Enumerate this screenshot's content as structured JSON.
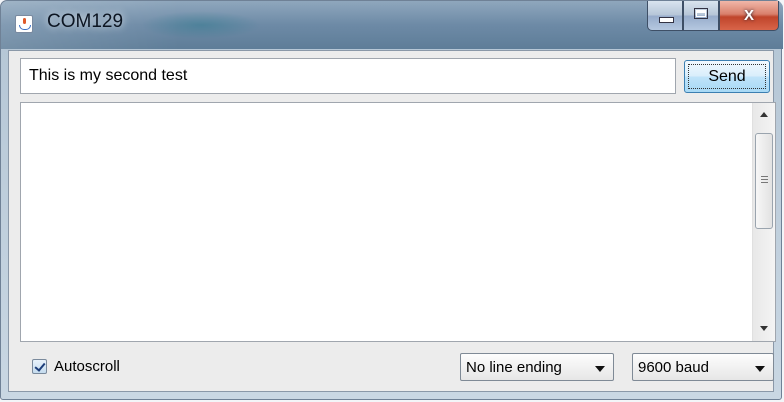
{
  "window": {
    "title": "COM129",
    "app_icon": "java-icon",
    "controls": {
      "minimize_icon": "minimize-icon",
      "maximize_icon": "maximize-icon",
      "close_icon": "close-icon",
      "close_glyph": "X"
    }
  },
  "send_bar": {
    "input_value": "This is my second test",
    "send_label": "Send"
  },
  "output": {
    "text": ""
  },
  "footer": {
    "autoscroll_label": "Autoscroll",
    "autoscroll_checked": true,
    "line_ending": "No line ending",
    "baud_rate": "9600 baud"
  },
  "colors": {
    "titlebar": "#6d8aa6",
    "send_button": "#bfe3f9",
    "close_button": "#c0452b"
  }
}
